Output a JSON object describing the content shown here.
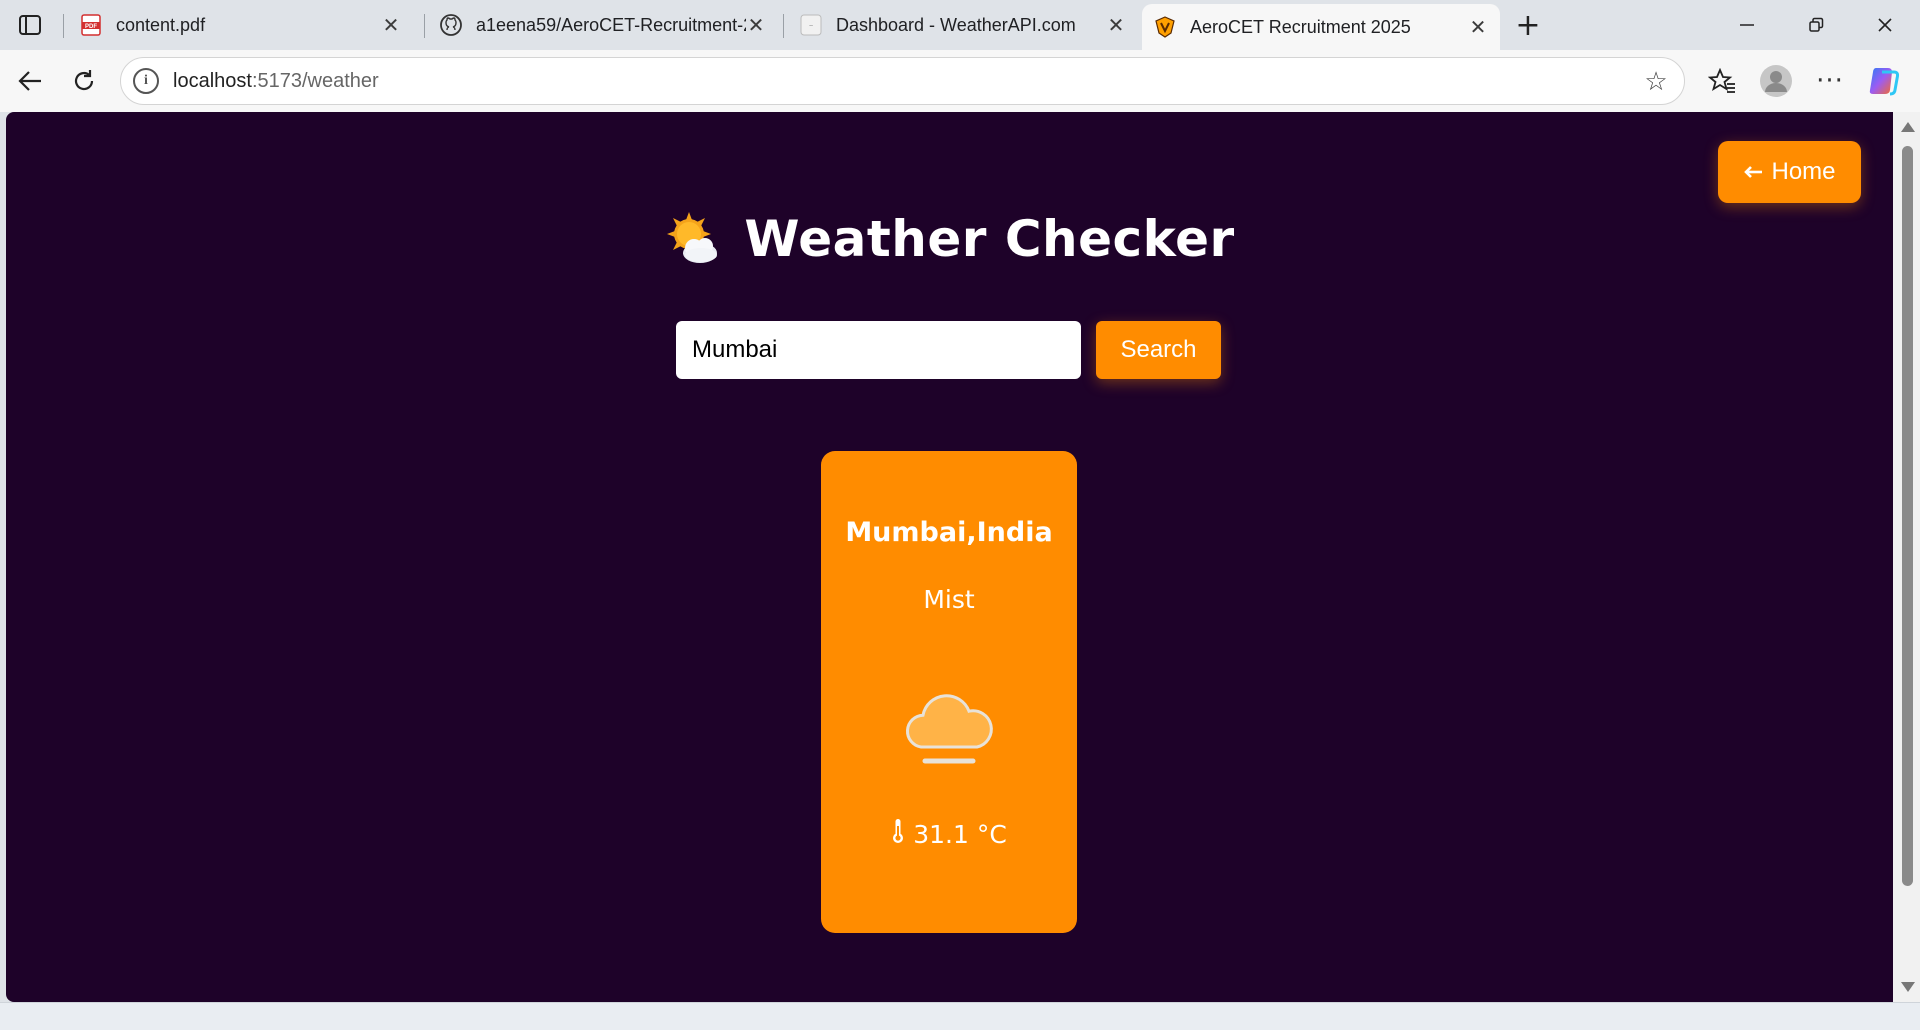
{
  "browser": {
    "tabs": [
      {
        "title": "content.pdf",
        "icon": "pdf-icon",
        "active": false
      },
      {
        "title": "a1eena59/AeroCET-Recruitment-2",
        "icon": "github-icon",
        "active": false
      },
      {
        "title": "Dashboard - WeatherAPI.com",
        "icon": "weatherapi-icon",
        "active": false
      },
      {
        "title": "AeroCET Recruitment 2025",
        "icon": "aerocet-logo-icon",
        "active": true
      }
    ],
    "address": {
      "host": "localhost",
      "path": ":5173/weather"
    }
  },
  "page": {
    "home_button": "Home",
    "title": "Weather Checker",
    "search": {
      "value": "Mumbai",
      "button": "Search"
    },
    "card": {
      "location": "Mumbai,India",
      "condition": "Mist",
      "temperature": "31.1 °C"
    }
  },
  "colors": {
    "background": "#1e0229",
    "accent": "#ff8c00",
    "text": "#ffffff"
  }
}
